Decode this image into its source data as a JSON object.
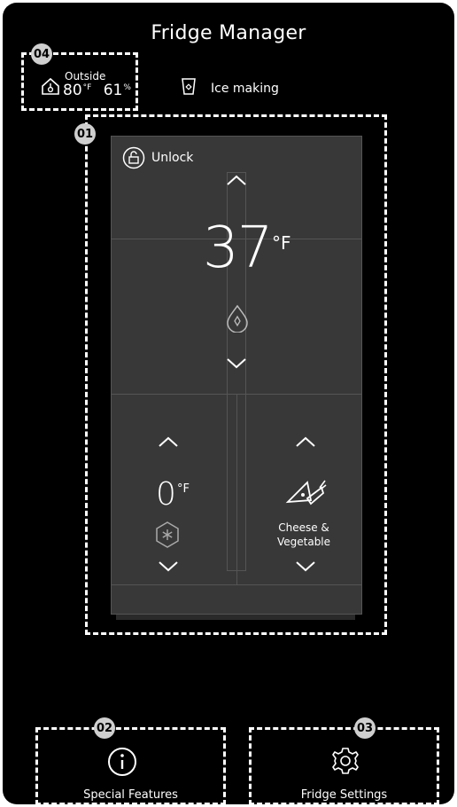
{
  "app": {
    "title": "Fridge Manager"
  },
  "badges": {
    "b1": "01",
    "b2": "02",
    "b3": "03",
    "b4": "04"
  },
  "outside": {
    "label": "Outside",
    "temp": "80",
    "temp_unit": "°F",
    "humidity": "61",
    "humidity_unit": "%"
  },
  "ice": {
    "label": "Ice making"
  },
  "fridge": {
    "lock_label": "Unlock",
    "main_temp": "37",
    "main_unit": "°F",
    "freezer_temp": "0",
    "freezer_unit": "°F",
    "flex_mode": "Cheese &\nVegetable"
  },
  "bottom": {
    "special_label": "Special Features",
    "settings_label": "Fridge Settings"
  },
  "icons": [
    "home-thermometer-icon",
    "ice-making-icon",
    "unlock-icon",
    "water-drop-icon",
    "snowflake-icon",
    "cheese-vegetable-icon",
    "info-icon",
    "gear-icon",
    "chevron-up-icon",
    "chevron-down-icon"
  ]
}
